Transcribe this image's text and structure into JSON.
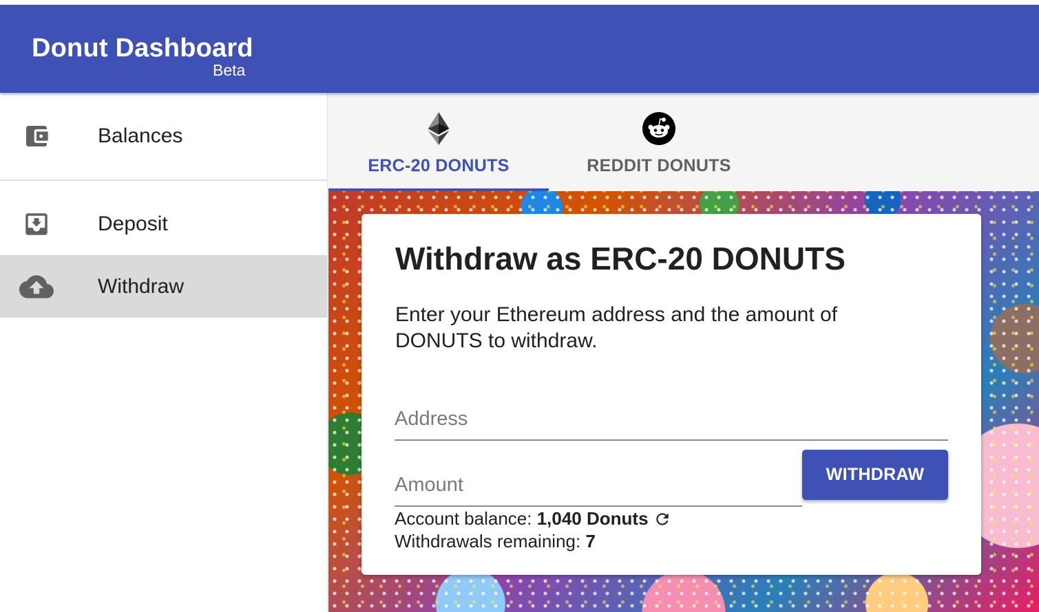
{
  "app": {
    "title": "Donut Dashboard",
    "subtitle": "Beta"
  },
  "sidebar": {
    "items": [
      {
        "label": "Balances",
        "icon": "wallet-icon"
      },
      {
        "label": "Deposit",
        "icon": "move-to-inbox-icon"
      },
      {
        "label": "Withdraw",
        "icon": "cloud-upload-icon",
        "selected": true
      }
    ]
  },
  "tabs": [
    {
      "label": "ERC-20 DONUTS",
      "icon": "ethereum-icon",
      "active": true
    },
    {
      "label": "REDDIT DONUTS",
      "icon": "reddit-icon",
      "active": false
    }
  ],
  "card": {
    "title": "Withdraw as ERC-20 DONUTS",
    "description": "Enter your Ethereum address and the amount of DONUTS to withdraw.",
    "address_placeholder": "Address",
    "amount_placeholder": "Amount",
    "withdraw_label": "WITHDRAW",
    "balance_label": "Account balance:",
    "balance_value": "1,040 Donuts",
    "remaining_label": "Withdrawals remaining:",
    "remaining_value": "7"
  },
  "colors": {
    "primary": "#3f51b5",
    "selected_nav": "#dadada",
    "tab_inactive": "#616161"
  }
}
